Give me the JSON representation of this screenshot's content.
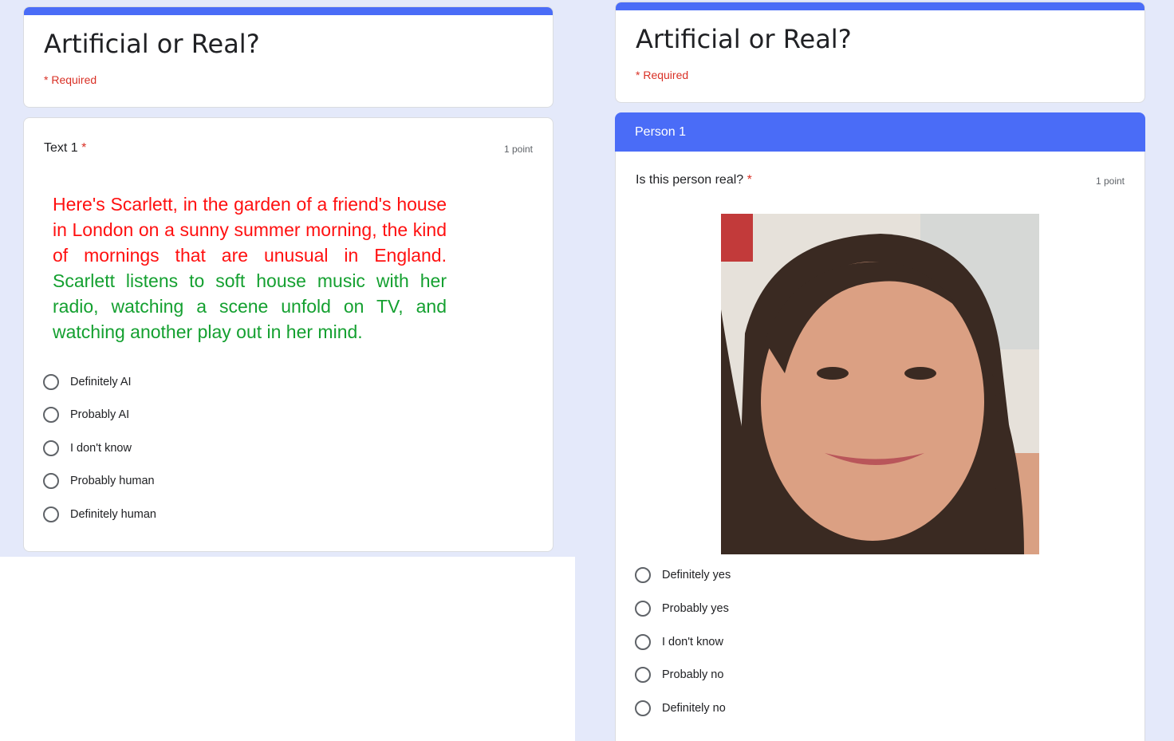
{
  "left_form": {
    "title": "Artificial or Real?",
    "required_note": "* Required",
    "question": {
      "title": "Text 1",
      "required_star": "*",
      "points": "1 point",
      "passage_red": "Here's Scarlett, in the garden of a friend's house in London on a sunny summer morning, the kind of mornings that are unusual in England.",
      "passage_green": "Scarlett listens to soft house music with her radio, watching a scene unfold on TV, and watching another play out in her mind.",
      "options": [
        "Definitely AI",
        "Probably AI",
        "I don't know",
        "Probably human",
        "Definitely human"
      ]
    }
  },
  "right_form": {
    "title": "Artificial or Real?",
    "required_note": "* Required",
    "section_title": "Person 1",
    "question": {
      "title": "Is this person real?",
      "required_star": "*",
      "points": "1 point",
      "options": [
        "Definitely yes",
        "Probably yes",
        "I don't know",
        "Probably no",
        "Definitely no"
      ]
    }
  },
  "colors": {
    "accent": "#4a6cf7",
    "background": "#e4e9fa",
    "required": "#d93025",
    "passage_red": "#ff1010",
    "passage_green": "#14a030"
  }
}
